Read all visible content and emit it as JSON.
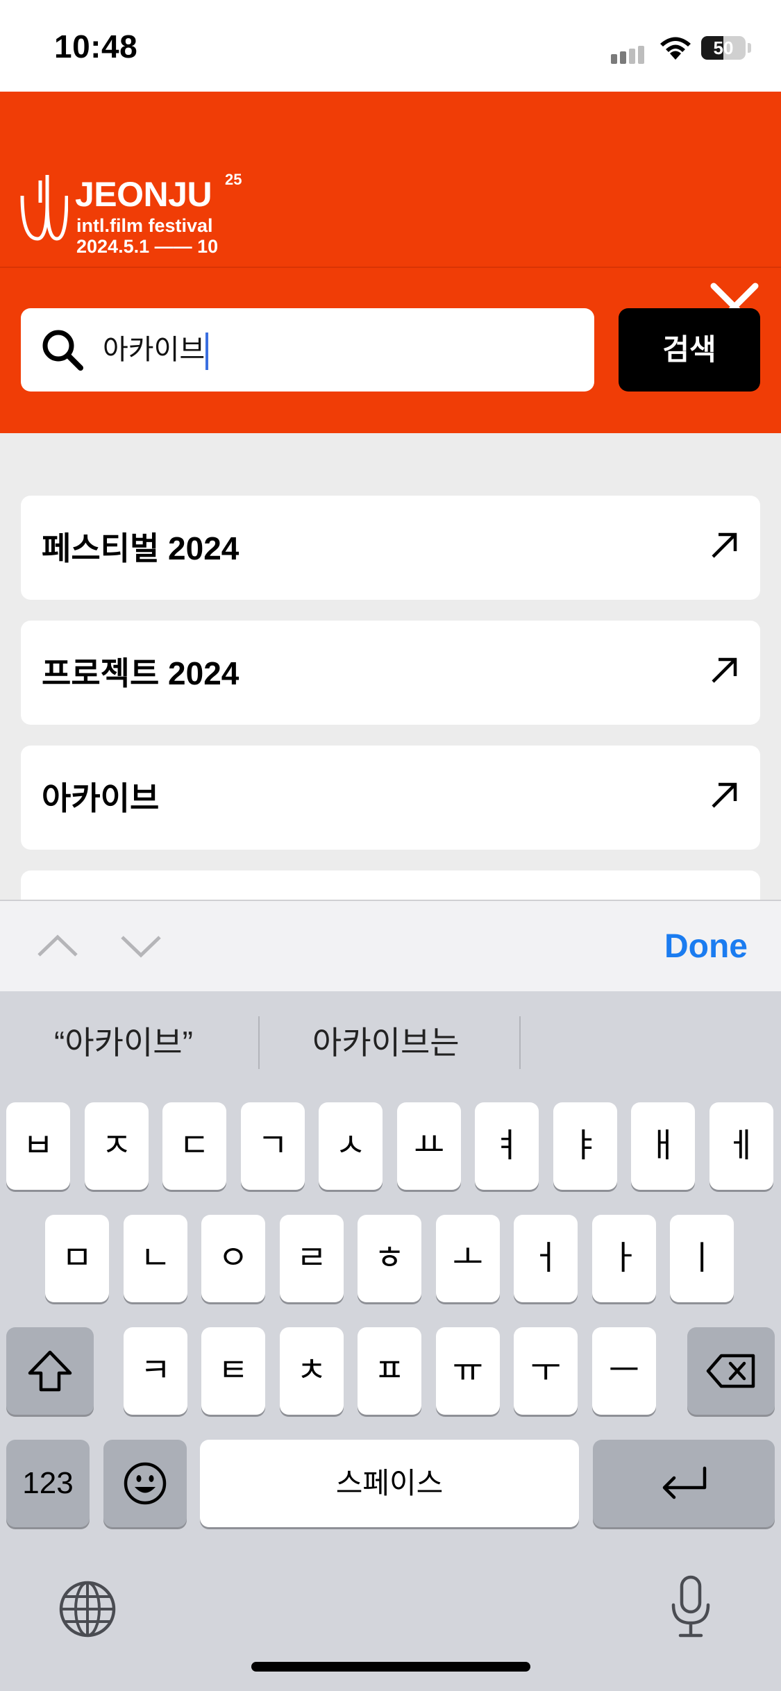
{
  "status": {
    "time": "10:48",
    "battery": "50"
  },
  "header": {
    "logo_name": "JEONJU",
    "logo_edition": "25",
    "logo_sub": "intl.film festival",
    "logo_dates": "2024.5.1 ―― 10",
    "brand_color": "#f03d06"
  },
  "search": {
    "value": "아카이브",
    "button_label": "검색"
  },
  "results": [
    {
      "label": "페스티벌 2024"
    },
    {
      "label": "프로젝트 2024"
    },
    {
      "label": "아카이브"
    }
  ],
  "accessory": {
    "done_label": "Done"
  },
  "keyboard": {
    "suggestions": [
      "“아카이브”",
      "아카이브는"
    ],
    "row1": [
      "ㅂ",
      "ㅈ",
      "ㄷ",
      "ㄱ",
      "ㅅ",
      "ㅛ",
      "ㅕ",
      "ㅑ",
      "ㅐ",
      "ㅔ"
    ],
    "row2": [
      "ㅁ",
      "ㄴ",
      "ㅇ",
      "ㄹ",
      "ㅎ",
      "ㅗ",
      "ㅓ",
      "ㅏ",
      "ㅣ"
    ],
    "row3": [
      "ㅋ",
      "ㅌ",
      "ㅊ",
      "ㅍ",
      "ㅠ",
      "ㅜ",
      "ㅡ"
    ],
    "numbers_label": "123",
    "space_label": "스페이스"
  }
}
